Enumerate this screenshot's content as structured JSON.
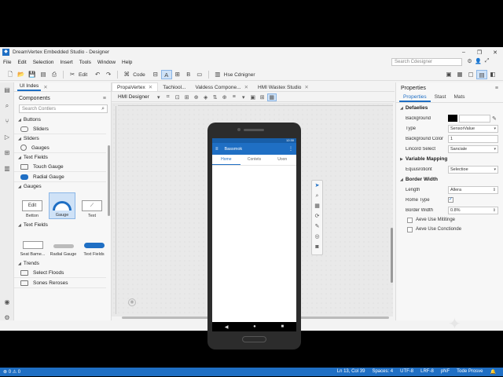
{
  "window": {
    "title": "DreamVertex Embedded Studio - Designer",
    "controls": [
      "–",
      "❐",
      "✕"
    ]
  },
  "menu": {
    "items": [
      "File",
      "Edit",
      "Selection",
      "Insert",
      "Tools",
      "Window",
      "Help"
    ],
    "search_placeholder": "Search Cdesigner",
    "right_icons": [
      "⚙",
      "👤",
      "⤢"
    ]
  },
  "toolbar": {
    "edit_label": "Edit",
    "code_label": "Code",
    "run_label": "Hse Cdnigner"
  },
  "left_panel": {
    "tab": "UI Indes",
    "title": "Components",
    "search_placeholder": "Search Contlers",
    "sections": [
      {
        "label": "Buttons",
        "items": [
          {
            "label": "Sliders",
            "icon": "slider-icon"
          }
        ]
      },
      {
        "label": "Sliders",
        "items": [
          {
            "label": "Gauges",
            "icon": "gauge-icon"
          }
        ]
      },
      {
        "label": "Text Fields",
        "items": [
          {
            "label": "Touch Gauge",
            "icon": "rect-icon"
          },
          {
            "label": "Radial Gauge",
            "icon": "toggle-icon"
          }
        ]
      }
    ],
    "gauges_section": "Gauges",
    "gauge_tiles": [
      {
        "label": "Betton",
        "thumb": "Edit"
      },
      {
        "label": "Gauge",
        "thumb": ""
      },
      {
        "label": "Text",
        "thumb": ""
      }
    ],
    "text_fields_section": "Text Fields",
    "text_tiles": [
      {
        "label": "Seat Bame..."
      },
      {
        "label": "Radial Gauge"
      },
      {
        "label": "Text Fields"
      }
    ],
    "trends_section": "Trends",
    "trends_items": [
      "Select Floods",
      "Sones Reroses"
    ]
  },
  "doc_tabs": [
    {
      "label": "PropaVertex",
      "active": true
    },
    {
      "label": "Tachiool..."
    },
    {
      "label": "Valdess Compone..."
    },
    {
      "label": "HMI Wastex Studio"
    }
  ],
  "designer": {
    "mode_label": "HMI Designer"
  },
  "phone": {
    "status_time": "12:30",
    "app_title": "Bassmok",
    "tabs": [
      "Home",
      "Contets",
      "Uoon"
    ],
    "active_tab": 0
  },
  "properties": {
    "title": "Properties",
    "tabs": [
      "Properties",
      "Stast",
      "Mats"
    ],
    "defaults_section": "Defaelies",
    "defaults": [
      {
        "key": "Background",
        "type": "color",
        "value": "#000000"
      },
      {
        "key": "Type",
        "value": "SensorValue"
      },
      {
        "key": "Background Color",
        "value": "1"
      },
      {
        "key": "Lincord Select",
        "value": "Sanciale"
      }
    ],
    "variable_section": "Variable Mapping",
    "variable_rows": [
      {
        "key": "Equusrotiont",
        "value": "Selectioe"
      }
    ],
    "border_section": "Border Width",
    "border_rows": [
      {
        "key": "Length",
        "value": "Allera"
      },
      {
        "key": "Rome Type",
        "value": "✓"
      },
      {
        "key": "Border Width",
        "value": "0.8%"
      }
    ],
    "checks": [
      "Aeve Use Mititinge",
      "Aeve Use Conctionde"
    ]
  },
  "statusbar": {
    "left": "⊗ 0  ⚠ 0",
    "right": [
      "Ln 13, Col 39",
      "Spaces: 4",
      "UTF-8",
      "LRF-8",
      "pNF",
      "Tode Prosve",
      "🔔"
    ]
  },
  "colors": {
    "accent": "#1f6fc4",
    "statusbar": "#1f6fc4"
  }
}
